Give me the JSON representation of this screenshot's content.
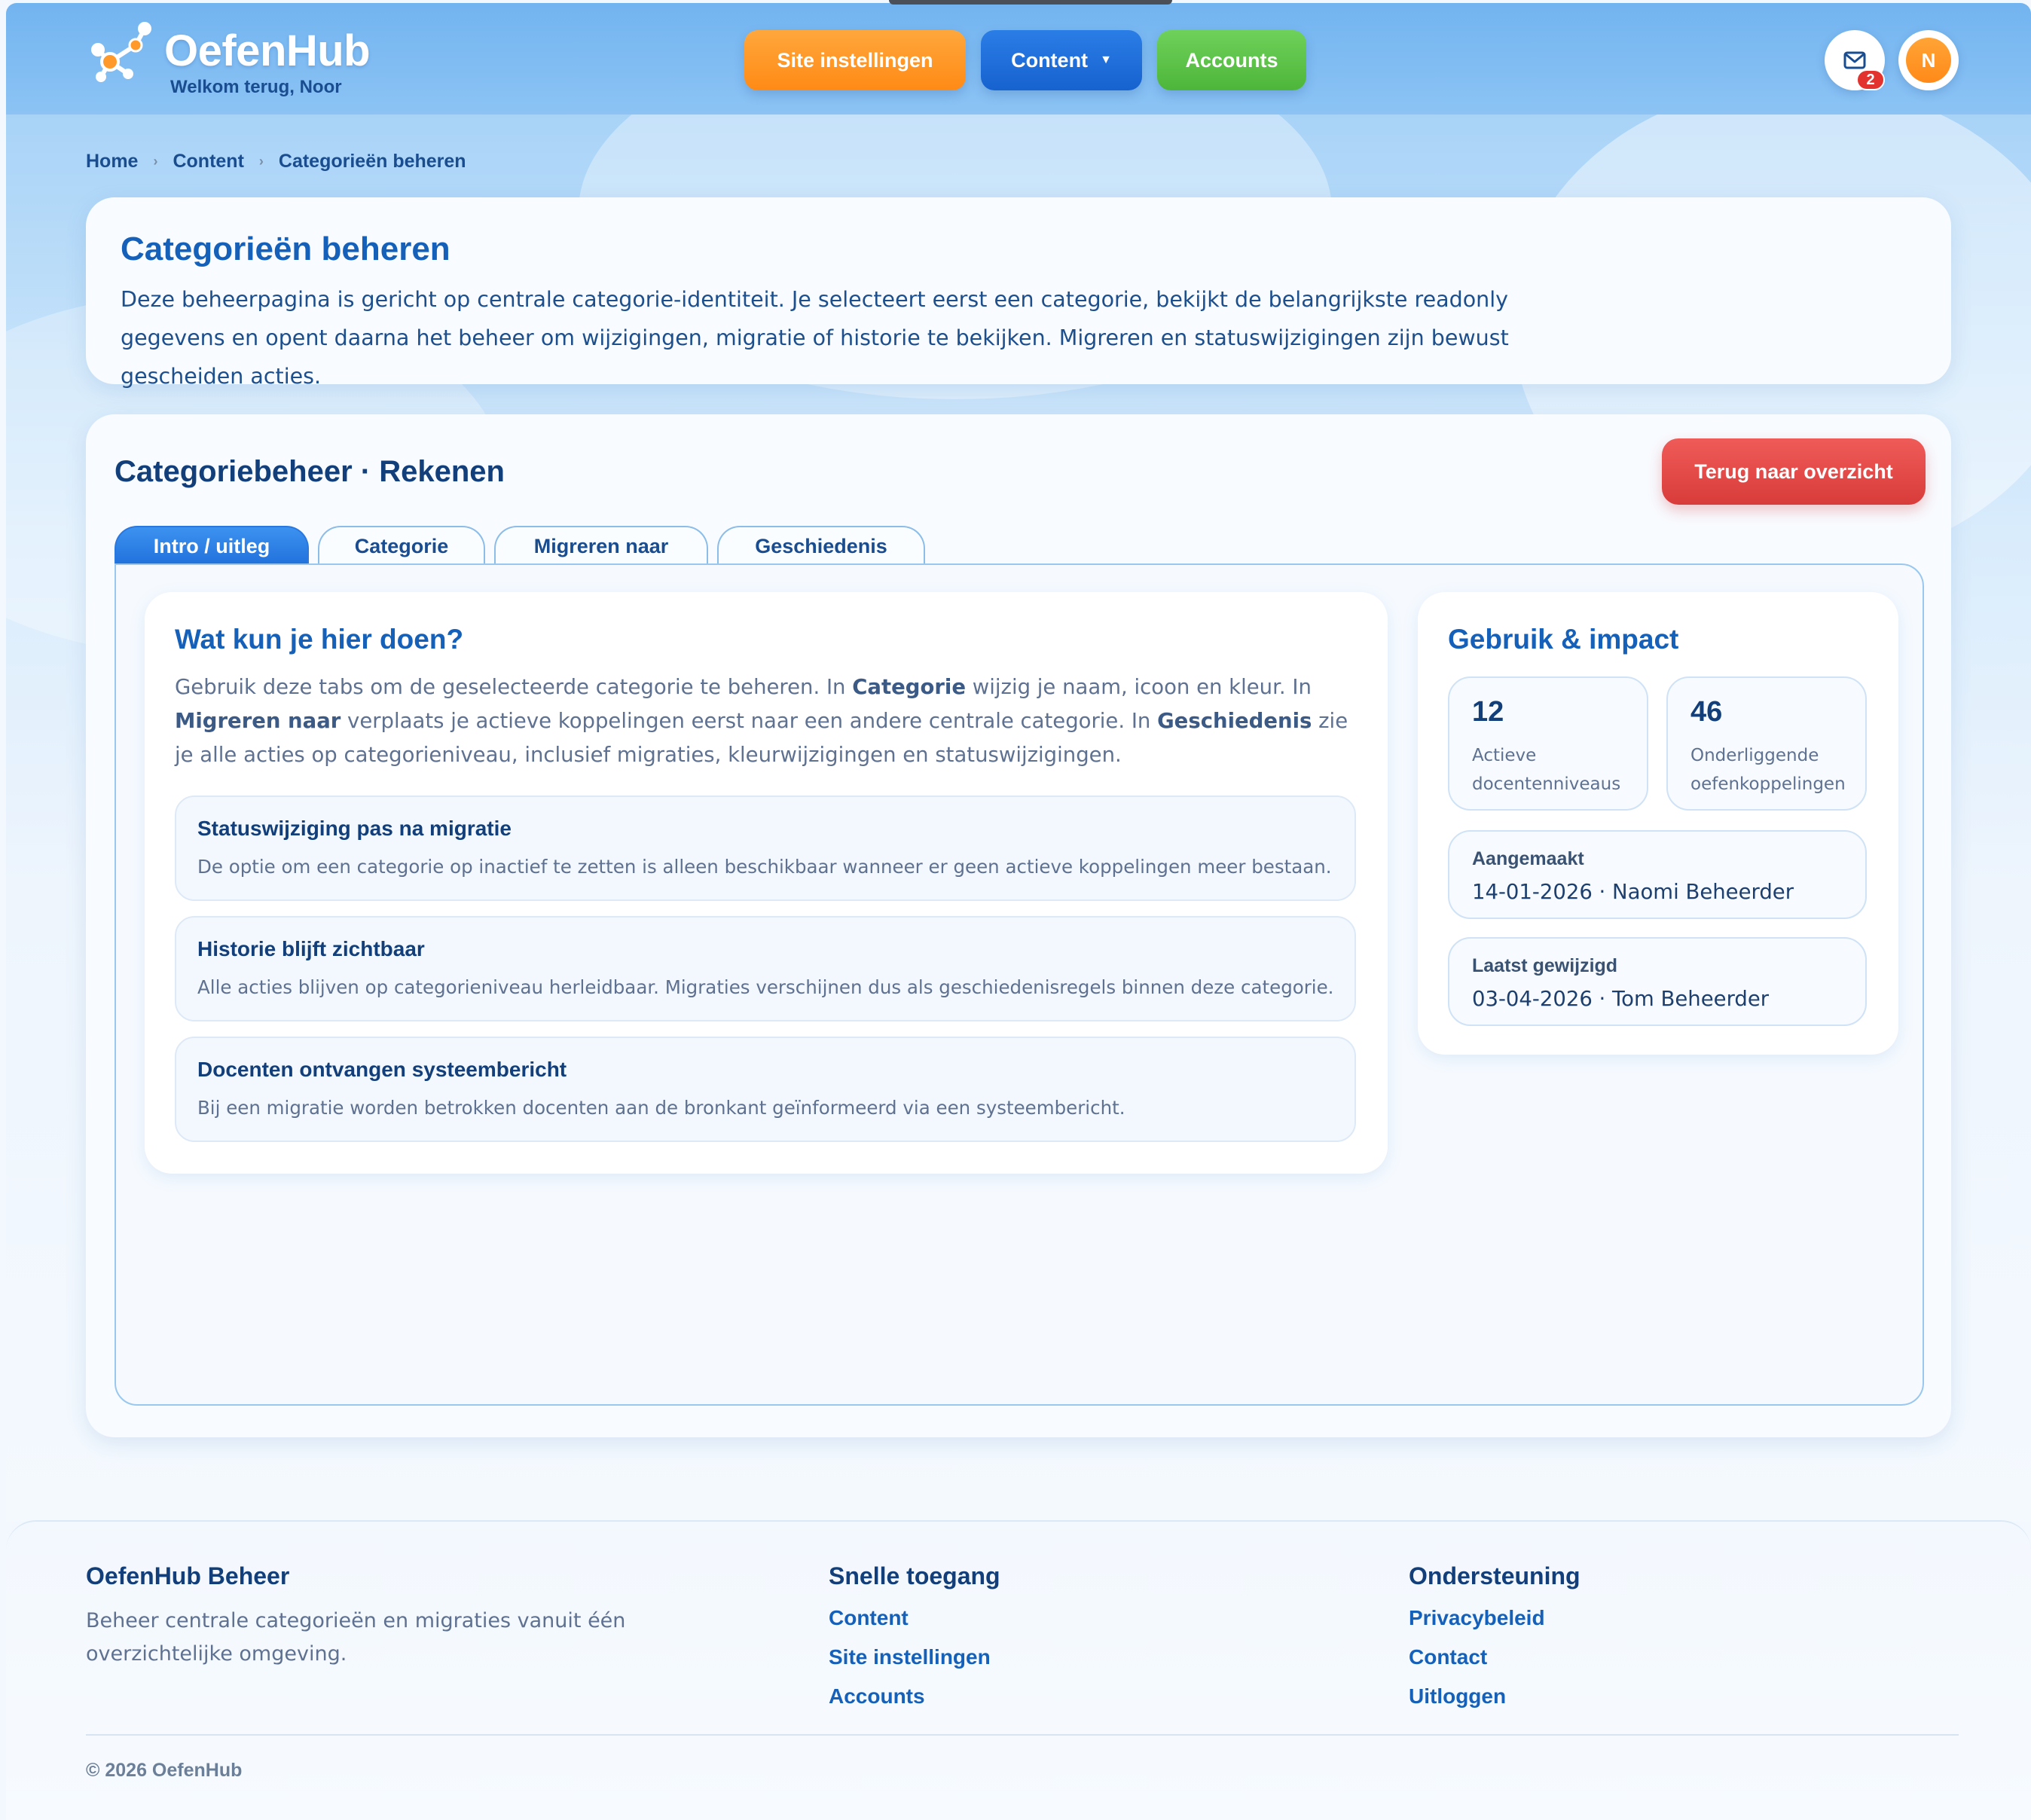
{
  "header": {
    "brand": "OefenHub",
    "welcome": "Welkom terug, Noor",
    "nav": {
      "site_settings": "Site instellingen",
      "content": "Content",
      "accounts": "Accounts"
    },
    "mail_badge": "2",
    "avatar_initial": "N",
    "colors": {
      "site_settings": "#ff9524",
      "content": "#1f6fdc",
      "accounts": "#5bc447"
    }
  },
  "breadcrumb": {
    "home": "Home",
    "content": "Content",
    "current": "Categorieën beheren"
  },
  "intro": {
    "title": "Categorieën beheren",
    "text": "Deze beheerpagina is gericht op centrale categorie-identiteit. Je selecteert eerst een categorie, bekijkt de belangrijkste readonly gegevens en opent daarna het beheer om wijzigingen, migratie of historie te bekijken. Migreren en statuswijzigingen zijn bewust gescheiden acties."
  },
  "main": {
    "title": "Categoriebeheer · Rekenen",
    "back_button": "Terug naar overzicht",
    "tabs": {
      "intro": "Intro / uitleg",
      "category": "Categorie",
      "migrate": "Migreren naar",
      "history": "Geschiedenis"
    },
    "active_tab": "Intro / uitleg"
  },
  "explain": {
    "title": "Wat kun je hier doen?",
    "p1": "Gebruik deze tabs om de geselecteerde categorie te beheren. In ",
    "b1": "Categorie",
    "p2": " wijzig je naam, icoon en kleur. In ",
    "b2": "Migreren naar",
    "p3": " verplaats je actieve koppelingen eerst naar een andere centrale categorie. In ",
    "b3": "Geschiedenis",
    "p4": " zie je alle acties op categorieniveau, inclusief migraties, kleurwijzigingen en statuswijzigingen.",
    "boxes": [
      {
        "title": "Statuswijziging pas na migratie",
        "text": "De optie om een categorie op inactief te zetten is alleen beschikbaar wanneer er geen actieve koppelingen meer bestaan."
      },
      {
        "title": "Historie blijft zichtbaar",
        "text": "Alle acties blijven op categorieniveau herleidbaar. Migraties verschijnen dus als geschiedenisregels binnen deze categorie."
      },
      {
        "title": "Docenten ontvangen systeembericht",
        "text": "Bij een migratie worden betrokken docenten aan de bronkant geïnformeerd via een systeembericht."
      }
    ]
  },
  "impact": {
    "title": "Gebruik & impact",
    "stats": [
      {
        "value": "12",
        "label": "Actieve docentenniveaus"
      },
      {
        "value": "46",
        "label": "Onderliggende oefenkoppelingen"
      }
    ],
    "created_label": "Aangemaakt",
    "created_value": "14-01-2026 · Naomi Beheerder",
    "modified_label": "Laatst gewijzigd",
    "modified_value": "03-04-2026 · Tom Beheerder"
  },
  "footer": {
    "col1_title": "OefenHub Beheer",
    "col1_text": "Beheer centrale categorieën en migraties vanuit één overzichtelijke omgeving.",
    "col2_title": "Snelle toegang",
    "col2_links": [
      "Content",
      "Site instellingen",
      "Accounts"
    ],
    "col3_title": "Ondersteuning",
    "col3_links": [
      "Privacybeleid",
      "Contact",
      "Uitloggen"
    ],
    "copyright": "© 2026 OefenHub"
  },
  "icons": {
    "logo": "molecule-logo-icon",
    "mail": "mail-icon",
    "caret": "chevron-down-icon",
    "breadcrumb_separator": "chevron-right-icon"
  }
}
